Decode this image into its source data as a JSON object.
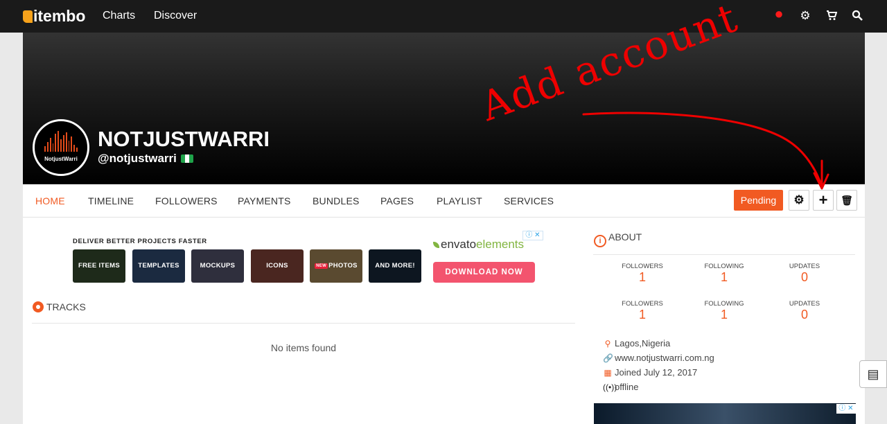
{
  "topnav": {
    "logo": "itembo",
    "links": [
      "Charts",
      "Discover"
    ],
    "icons": [
      "notification-icon",
      "gear-icon",
      "cart-icon",
      "search-icon"
    ]
  },
  "profile": {
    "name": "NOTJUSTWARRI",
    "handle": "@notjustwarri",
    "avatar_text": "NotjustWarri"
  },
  "tabs": [
    "HOME",
    "TIMELINE",
    "FOLLOWERS",
    "PAYMENTS",
    "BUNDLES",
    "PAGES",
    "PLAYLIST",
    "SERVICES"
  ],
  "actions": {
    "pending": "Pending",
    "gear": "⚙",
    "add": "+",
    "delete": "🗑"
  },
  "ad": {
    "headline": "DELIVER BETTER PROJECTS FASTER",
    "tiles": [
      "FREE ITEMS",
      "TEMPLATES",
      "MOCKUPS",
      "ICONS",
      "PHOTOS",
      "AND MORE!"
    ],
    "new_tag": "NEW",
    "brand_envato": "envato",
    "brand_elements": "elements",
    "cta": "DOWNLOAD NOW",
    "adchoice": "ⓘ ✕"
  },
  "tracks": {
    "title": "TRACKS",
    "empty": "No items found"
  },
  "about": {
    "title": "ABOUT",
    "stats": [
      {
        "label": "FOLLOWERS",
        "value": "1"
      },
      {
        "label": "FOLLOWING",
        "value": "1"
      },
      {
        "label": "UPDATES",
        "value": "0"
      },
      {
        "label": "FOLLOWERS",
        "value": "1"
      },
      {
        "label": "FOLLOWING",
        "value": "1"
      },
      {
        "label": "UPDATES",
        "value": "0"
      }
    ],
    "location": "Lagos,Nigeria",
    "website": "www.notjustwarri.com.ng",
    "joined": "Joined July 12, 2017",
    "status": "offline"
  },
  "annotation": {
    "text": "Add account",
    "color": "#ee0000"
  },
  "colors": {
    "accent": "#f15a22",
    "nav_bg": "#1a1a1a"
  }
}
